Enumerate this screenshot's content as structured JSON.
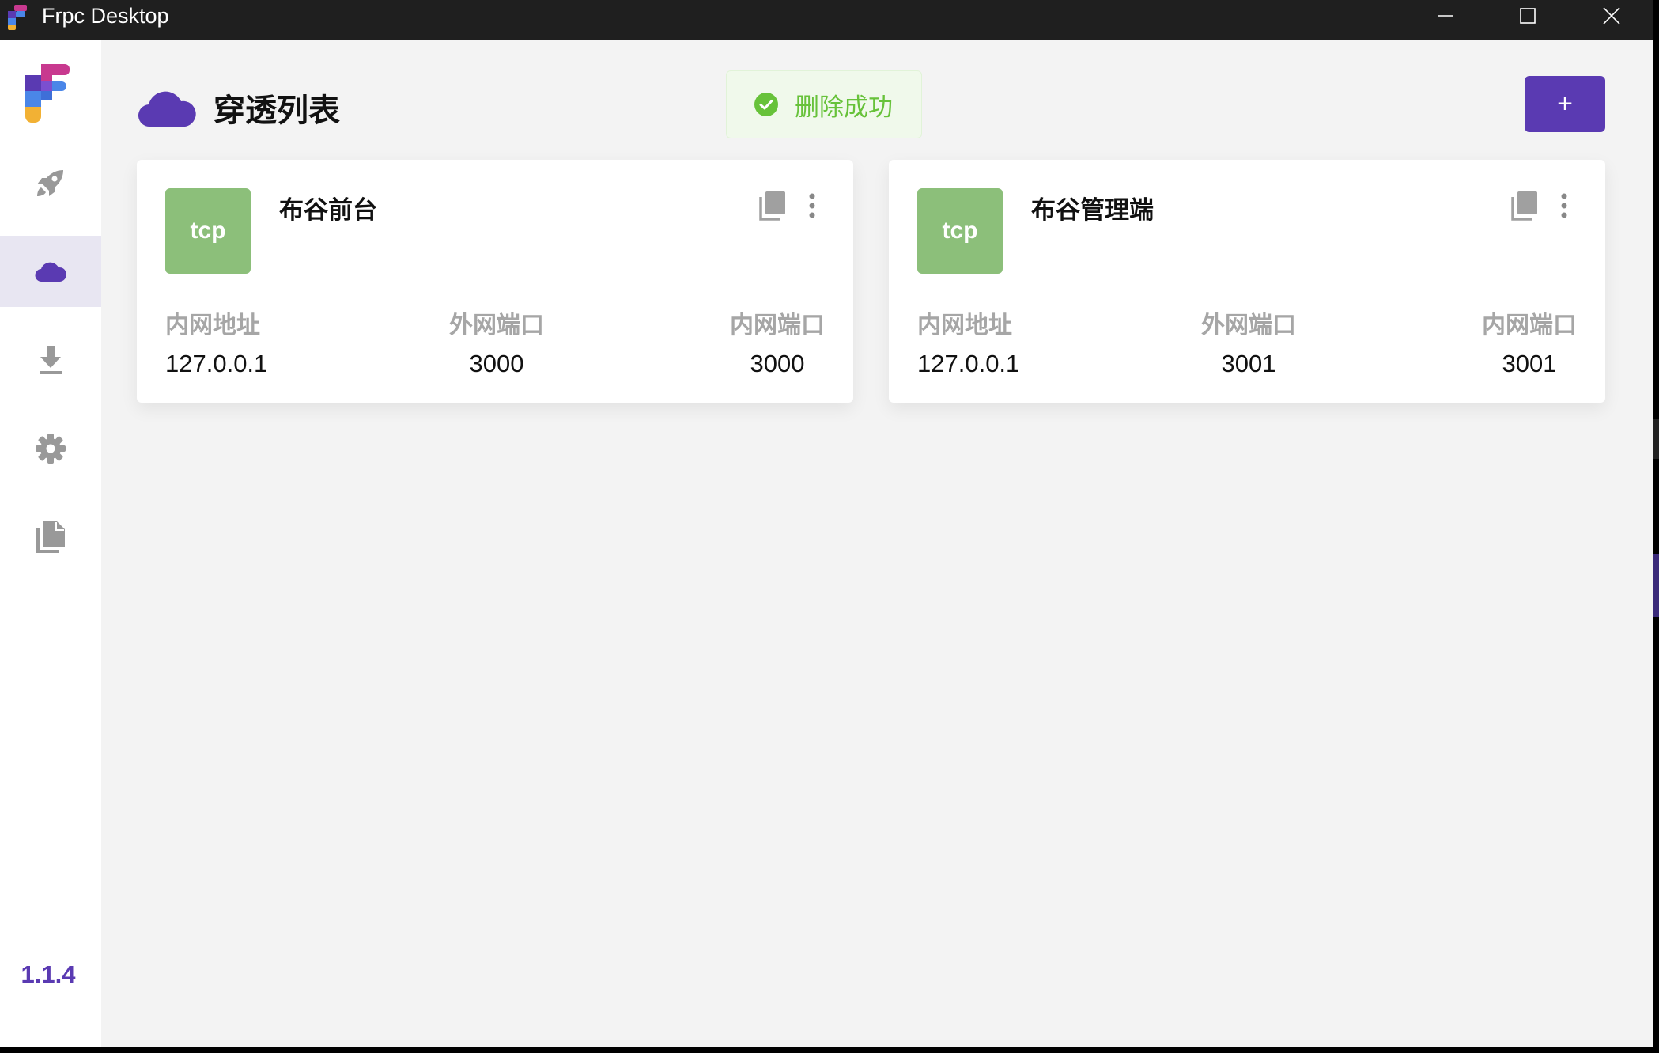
{
  "window": {
    "title": "Frpc Desktop",
    "minimize_icon": "minimize-icon",
    "maximize_icon": "maximize-icon",
    "close_icon": "close-icon"
  },
  "sidebar": {
    "items": [
      {
        "icon": "rocket-icon",
        "active": false
      },
      {
        "icon": "cloud-icon",
        "active": true
      },
      {
        "icon": "download-icon",
        "active": false
      },
      {
        "icon": "gear-icon",
        "active": false
      },
      {
        "icon": "document-copy-icon",
        "active": false
      }
    ],
    "version": "1.1.4"
  },
  "header": {
    "title": "穿透列表",
    "add_label": "+"
  },
  "toast": {
    "message": "删除成功"
  },
  "proxies": [
    {
      "type": "tcp",
      "name": "布谷前台",
      "local_ip_label": "内网地址",
      "local_ip": "127.0.0.1",
      "remote_port_label": "外网端口",
      "remote_port": "3000",
      "local_port_label": "内网端口",
      "local_port": "3000"
    },
    {
      "type": "tcp",
      "name": "布谷管理端",
      "local_ip_label": "内网地址",
      "local_ip": "127.0.0.1",
      "remote_port_label": "外网端口",
      "remote_port": "3001",
      "local_port_label": "内网端口",
      "local_port": "3001"
    }
  ],
  "colors": {
    "accent": "#5a3ab2",
    "badge": "#8cbf7a",
    "success": "#67c23a",
    "background": "#f3f3f3"
  }
}
